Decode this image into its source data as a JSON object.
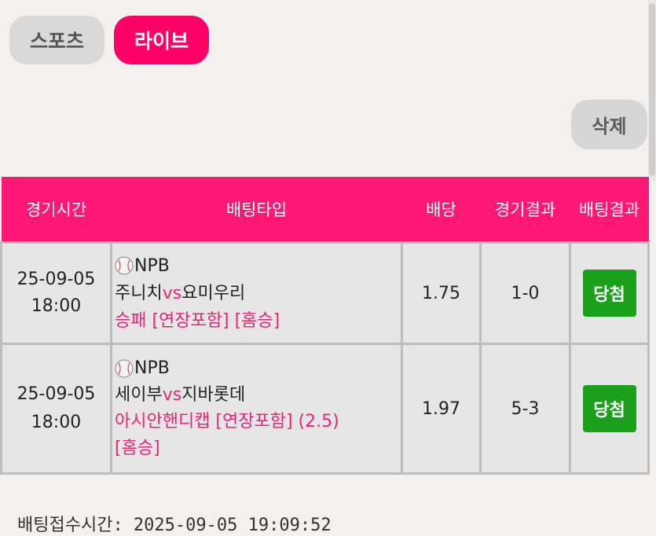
{
  "tabs": [
    {
      "label": "스포츠",
      "active": false
    },
    {
      "label": "라이브",
      "active": true
    }
  ],
  "delete_label": "삭제",
  "table": {
    "headers": [
      "경기시간",
      "배팅타입",
      "배당",
      "경기결과",
      "배팅결과"
    ],
    "rows": [
      {
        "date": "25-09-05",
        "time": "18:00",
        "league": "NPB",
        "home": "주니치",
        "vs": "vs",
        "away": "요미우리",
        "bet_type": "승패 [연장포함] [홈승]",
        "bet_type_extra": "",
        "odds": "1.75",
        "score": "1-0",
        "result": "당첨"
      },
      {
        "date": "25-09-05",
        "time": "18:00",
        "league": "NPB",
        "home": "세이부",
        "vs": "vs",
        "away": "지바롯데",
        "bet_type": "아시안핸디캡 [연장포함] (2.5)",
        "bet_type_extra": "[홈승]",
        "odds": "1.97",
        "score": "5-3",
        "result": "당첨"
      }
    ]
  },
  "footer_text": "배팅접수시간: 2025-09-05 19:09:52",
  "colors": {
    "accent": "#ff1775",
    "win": "#1aa01a",
    "bet_type_text": "#e8247a"
  },
  "icons": {
    "sport": "baseball-icon"
  }
}
